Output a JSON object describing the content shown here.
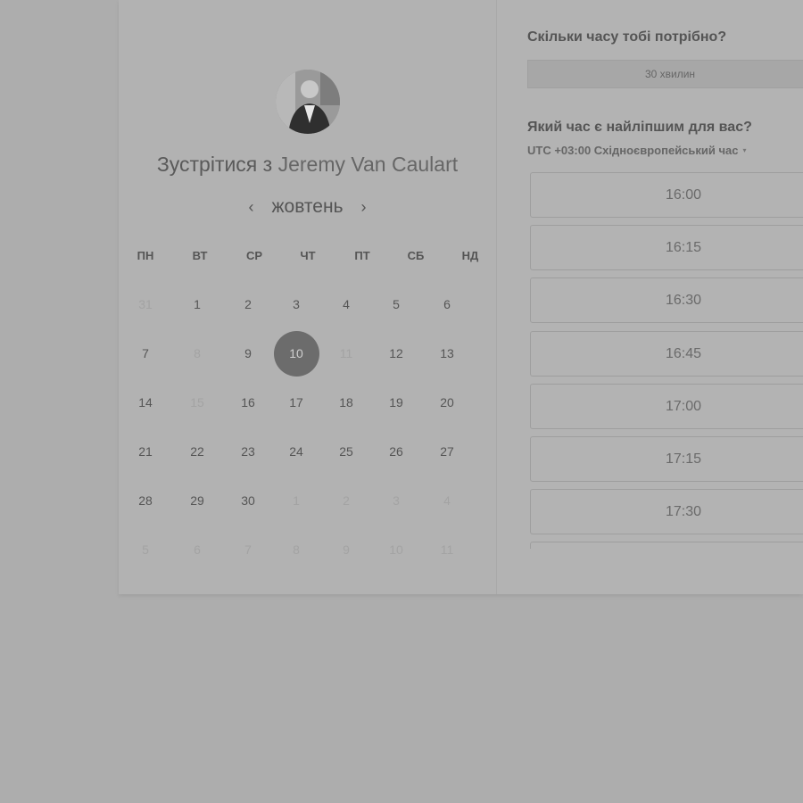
{
  "host": {
    "prefix": "Зустрітися з",
    "name": "Jeremy Van Caulart"
  },
  "calendar": {
    "month": "жовтень",
    "prev_icon": "chevron-left-icon",
    "next_icon": "chevron-right-icon",
    "weekdays": [
      "ПН",
      "ВТ",
      "СР",
      "ЧТ",
      "ПТ",
      "СБ",
      "НД"
    ],
    "weeks": [
      [
        {
          "d": "31",
          "dim": true
        },
        {
          "d": "1"
        },
        {
          "d": "2"
        },
        {
          "d": "3"
        },
        {
          "d": "4"
        },
        {
          "d": "5"
        },
        {
          "d": "6"
        }
      ],
      [
        {
          "d": "7"
        },
        {
          "d": "8",
          "dim": true
        },
        {
          "d": "9"
        },
        {
          "d": "10",
          "selected": true
        },
        {
          "d": "11",
          "dim": true
        },
        {
          "d": "12"
        },
        {
          "d": "13"
        }
      ],
      [
        {
          "d": "14"
        },
        {
          "d": "15",
          "dim": true
        },
        {
          "d": "16"
        },
        {
          "d": "17"
        },
        {
          "d": "18"
        },
        {
          "d": "19"
        },
        {
          "d": "20"
        }
      ],
      [
        {
          "d": "21"
        },
        {
          "d": "22"
        },
        {
          "d": "23"
        },
        {
          "d": "24"
        },
        {
          "d": "25"
        },
        {
          "d": "26"
        },
        {
          "d": "27"
        }
      ],
      [
        {
          "d": "28"
        },
        {
          "d": "29"
        },
        {
          "d": "30"
        },
        {
          "d": "1",
          "dim": true
        },
        {
          "d": "2",
          "dim": true
        },
        {
          "d": "3",
          "dim": true
        },
        {
          "d": "4",
          "dim": true
        }
      ],
      [
        {
          "d": "5",
          "dim": true
        },
        {
          "d": "6",
          "dim": true
        },
        {
          "d": "7",
          "dim": true
        },
        {
          "d": "8",
          "dim": true
        },
        {
          "d": "9",
          "dim": true
        },
        {
          "d": "10",
          "dim": true
        },
        {
          "d": "11",
          "dim": true
        }
      ]
    ]
  },
  "booking": {
    "duration_question": "Скільки часу тобі потрібно?",
    "duration_value": "30 хвилин",
    "time_question": "Який час є найліпшим для вас?",
    "timezone": "UTC +03:00 Східноєвропейський час",
    "timezone_caret": "▾",
    "slots": [
      "16:00",
      "16:15",
      "16:30",
      "16:45",
      "17:00",
      "17:15",
      "17:30",
      ""
    ]
  },
  "colors": {
    "selected_day": "#6c6c6c",
    "background": "#adadad",
    "card": "#b3b3b3"
  }
}
